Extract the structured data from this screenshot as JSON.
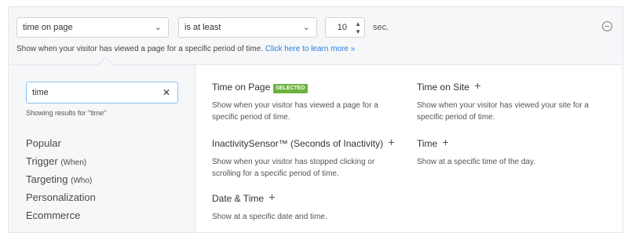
{
  "rule": {
    "condition_value": "time on page",
    "operator_value": "is at least",
    "amount_value": "10",
    "unit": "sec.",
    "help_text": "Show when your visitor has viewed a page for a specific period of time.",
    "help_link": "Click here to learn more »"
  },
  "search": {
    "value": "time",
    "results_note": "Showing results for \"time\""
  },
  "categories": [
    {
      "label": "Popular",
      "sub": ""
    },
    {
      "label": "Trigger",
      "sub": "(When)"
    },
    {
      "label": "Targeting",
      "sub": "(Who)"
    },
    {
      "label": "Personalization",
      "sub": ""
    },
    {
      "label": "Ecommerce",
      "sub": ""
    }
  ],
  "options": [
    {
      "title": "Time on Page",
      "badge": "SELECTED",
      "desc": "Show when your visitor has viewed a page for a specific period of time."
    },
    {
      "title": "Time on Site",
      "desc": "Show when your visitor has viewed your site for a specific period of time."
    },
    {
      "title": "InactivitySensor™ (Seconds of Inactivity)",
      "desc": "Show when your visitor has stopped clicking or scrolling for a specific period of time."
    },
    {
      "title": "Time",
      "desc": "Show at a specific time of the day."
    },
    {
      "title": "Date & Time",
      "desc": "Show at a specific date and time."
    }
  ],
  "colors": {
    "accent": "#2a7de1",
    "badge": "#6cb33e"
  }
}
